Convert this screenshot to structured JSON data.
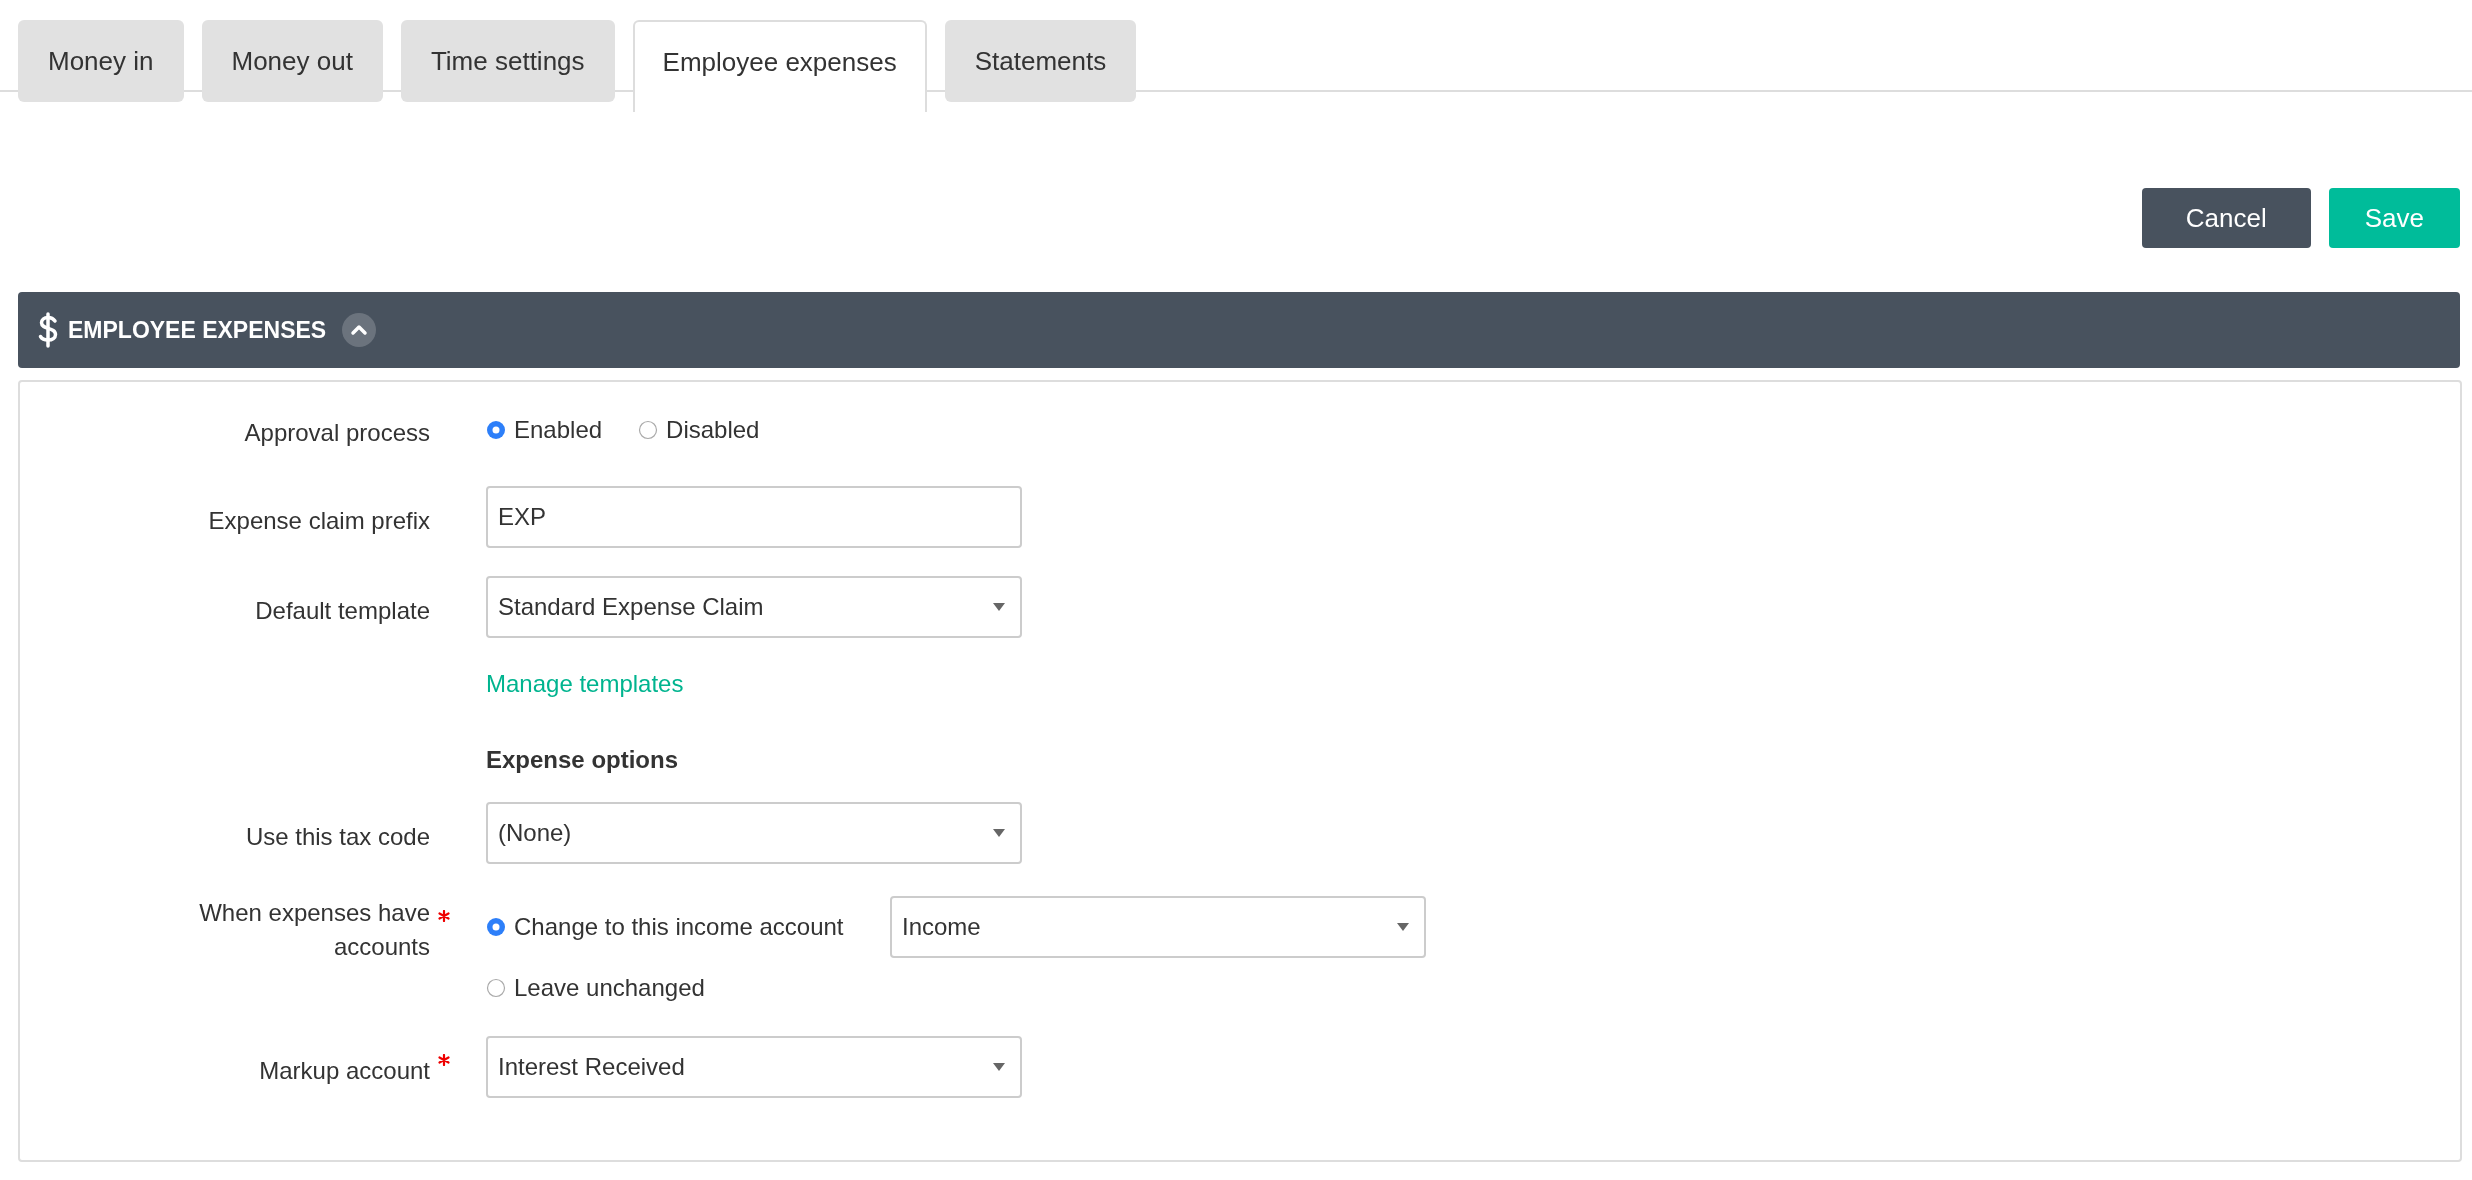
{
  "tabs": [
    {
      "label": "Money in",
      "selected": false
    },
    {
      "label": "Money out",
      "selected": false
    },
    {
      "label": "Time settings",
      "selected": false
    },
    {
      "label": "Employee expenses",
      "selected": true
    },
    {
      "label": "Statements",
      "selected": false
    }
  ],
  "buttons": [
    {
      "label": "Cancel",
      "kind": "secondary"
    },
    {
      "label": "Save",
      "kind": "primary"
    }
  ],
  "section": {
    "title": "EMPLOYEE EXPENSES",
    "expanded": true
  },
  "fields": [
    {
      "kind": "radio",
      "label": "Approval process",
      "required": false,
      "options": [
        {
          "label": "Enabled",
          "selected": true
        },
        {
          "label": "Disabled",
          "selected": false
        }
      ]
    },
    {
      "kind": "text",
      "label": "Expense claim prefix",
      "required": false,
      "value": "EXP"
    },
    {
      "kind": "select",
      "label": "Default template",
      "required": false,
      "value": "Standard Expense Claim"
    },
    {
      "kind": "link",
      "text": "Manage templates"
    },
    {
      "kind": "heading",
      "text": "Expense options"
    },
    {
      "kind": "select",
      "label": "Use this tax code",
      "required": false,
      "value": "(None)"
    },
    {
      "kind": "radio",
      "label": "When expenses have accounts",
      "required": true,
      "options": [
        {
          "label": "Change to this income account",
          "selected": true,
          "select": "Income"
        },
        {
          "label": "Leave unchanged",
          "selected": false
        }
      ]
    },
    {
      "kind": "select",
      "label": "Markup account",
      "required": true,
      "value": "Interest Received"
    }
  ]
}
